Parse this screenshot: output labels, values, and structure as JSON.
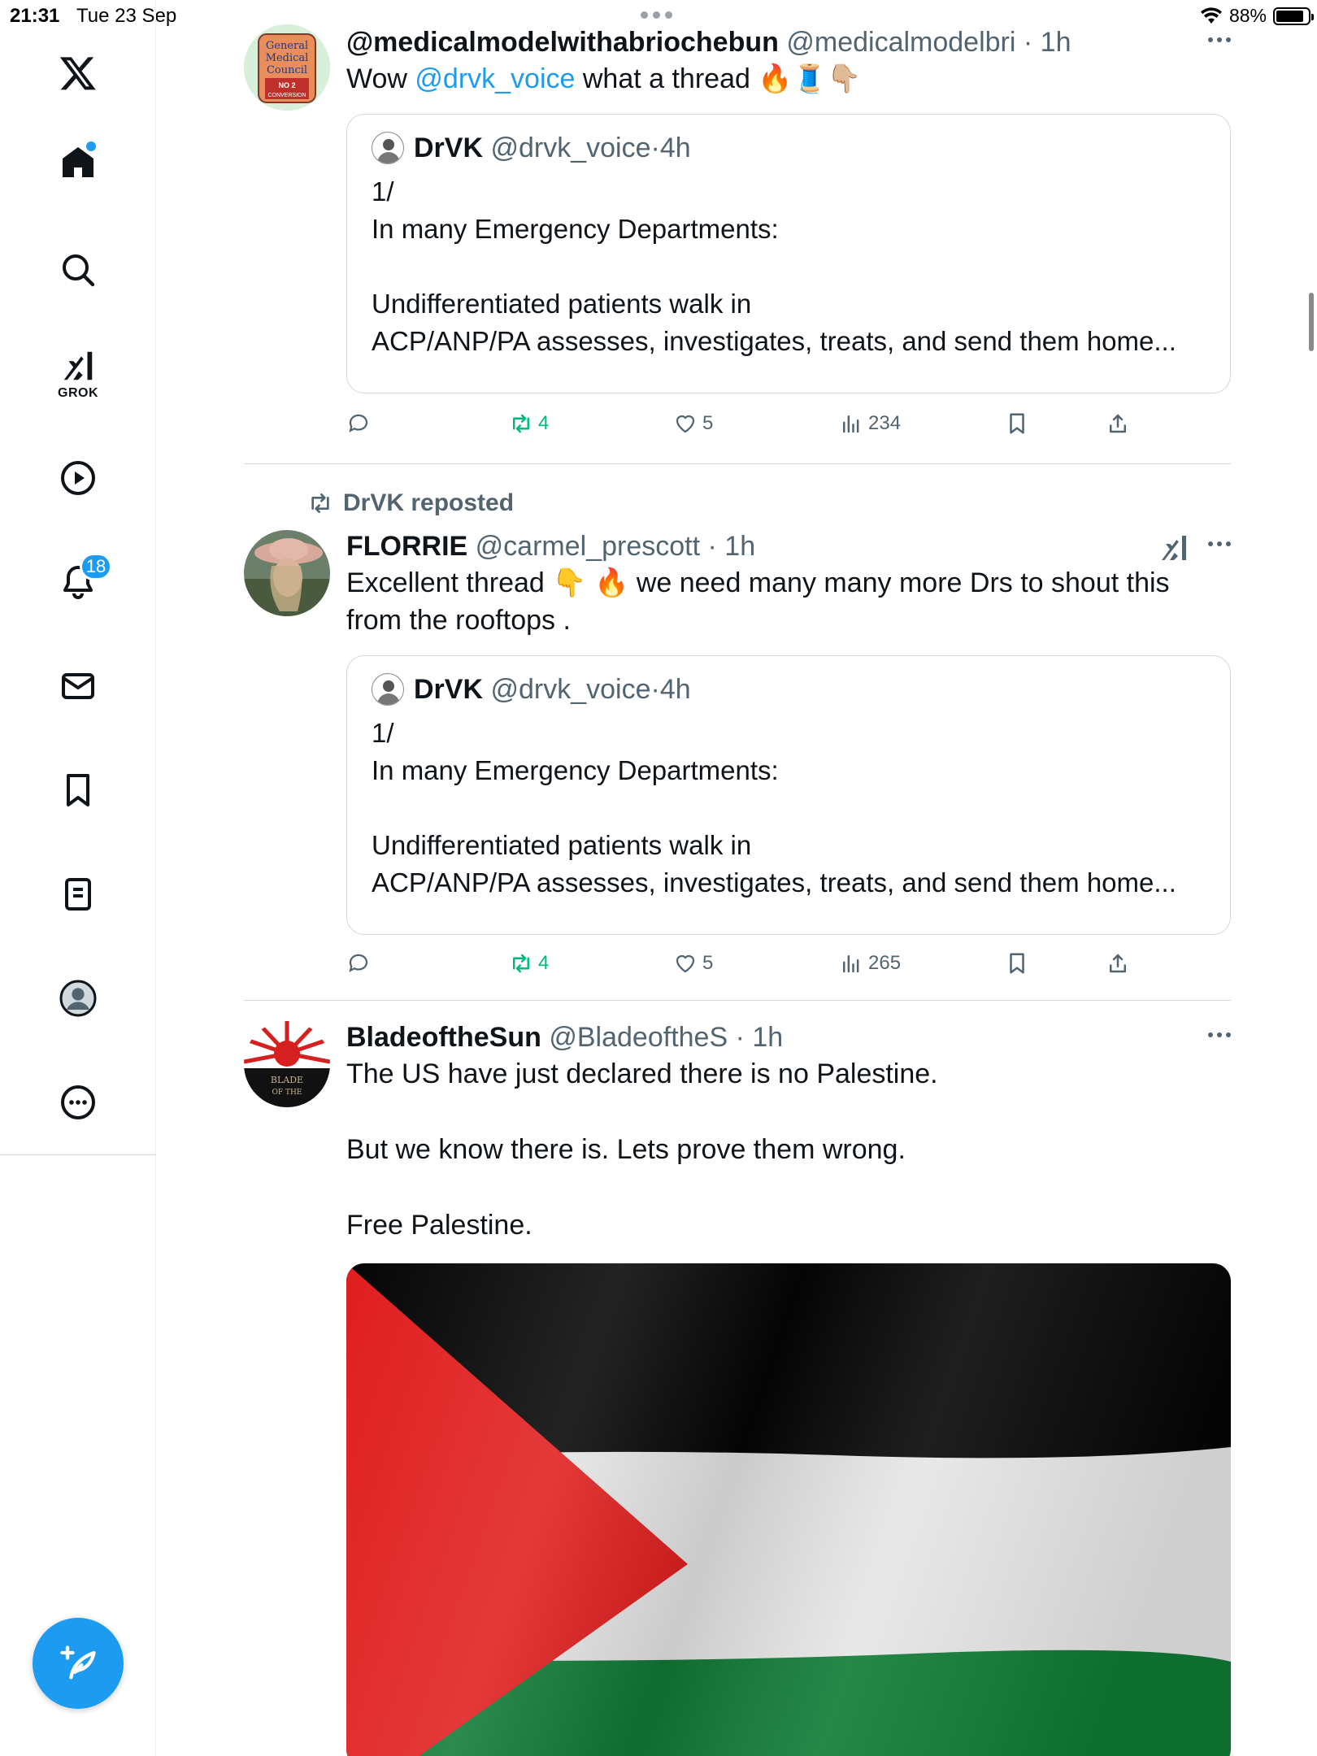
{
  "status_bar": {
    "time": "21:31",
    "date": "Tue 23 Sep",
    "battery": "88%",
    "battery_level": 0.88
  },
  "nav": {
    "grok_label": "GROK",
    "notifications_badge": "18"
  },
  "posts": [
    {
      "name": "@medicalmodelwithabriochebun",
      "handle": "@medicalmodelbri",
      "dot": "·",
      "time": "1h",
      "text_before": "Wow ",
      "mention": "@drvk_voice",
      "text_after": " what a thread 🔥🧵👇🏼",
      "avatar_text": [
        "General",
        "Medical",
        "Council",
        "NO 2",
        "CONVERSION"
      ],
      "quote": {
        "name": "DrVK",
        "handle": "@drvk_voice",
        "dot": "·",
        "time": "4h",
        "text": "1/\nIn many Emergency Departments:\n\nUndifferentiated patients walk in\nACP/ANP/PA assesses, investigates, treats, and send them home..."
      },
      "reposts": "4",
      "likes": "5",
      "views": "234"
    },
    {
      "repost_label": "DrVK reposted",
      "name": "FLORRIE",
      "handle": "@carmel_prescott",
      "dot": "·",
      "time": "1h",
      "text": "Excellent thread 👇 🔥 we need many many more Drs to shout this\nfrom the rooftops .",
      "quote": {
        "name": "DrVK",
        "handle": "@drvk_voice",
        "dot": "·",
        "time": "4h",
        "text": "1/\nIn many Emergency Departments:\n\nUndifferentiated patients walk in\nACP/ANP/PA assesses, investigates, treats, and send them home..."
      },
      "reposts": "4",
      "likes": "5",
      "views": "265"
    },
    {
      "name": "BladeoftheSun",
      "handle": "@BladeoftheS",
      "dot": "·",
      "time": "1h",
      "avatar_text": [
        "BLADE",
        "OF THE"
      ],
      "text": "The US have just declared there is no Palestine.\n\nBut we know there is. Lets prove them wrong.\n\nFree Palestine."
    }
  ],
  "colors": {
    "accent": "#1d9bf0",
    "text": "#0f1419",
    "muted": "#536471",
    "retweet": "#00ba7c",
    "border": "#cfd9de"
  }
}
